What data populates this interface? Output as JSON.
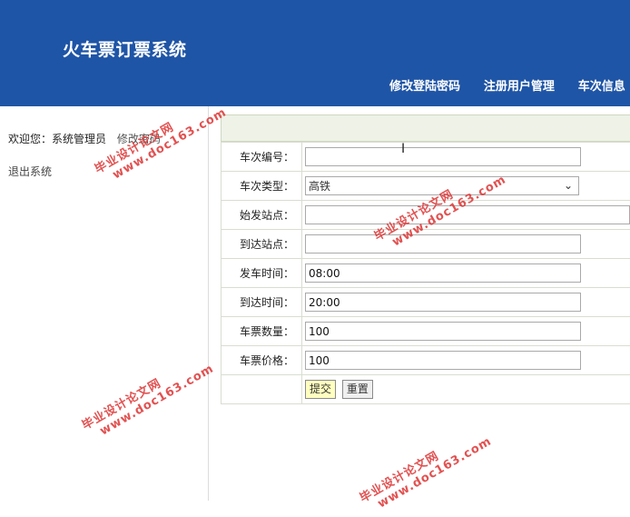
{
  "header": {
    "title": "火车票订票系统",
    "nav": [
      "修改登陆密码",
      "注册用户管理",
      "车次信息"
    ]
  },
  "sidebar": {
    "welcome_prefix": "欢迎您：",
    "role": "系统管理员",
    "change_password": "修改密码",
    "logout": "退出系统"
  },
  "form": {
    "fields": [
      {
        "label": "车次编号：",
        "value": ""
      },
      {
        "label": "车次类型：",
        "value": "高铁"
      },
      {
        "label": "始发站点：",
        "value": ""
      },
      {
        "label": "到达站点：",
        "value": ""
      },
      {
        "label": "发车时间：",
        "value": "08:00"
      },
      {
        "label": "到达时间：",
        "value": "20:00"
      },
      {
        "label": "车票数量：",
        "value": "100"
      },
      {
        "label": "车票价格：",
        "value": "100"
      }
    ],
    "submit": "提交",
    "reset": "重置"
  },
  "watermark": {
    "line1": "毕业设计论文网",
    "line2": "www.doc163.com"
  }
}
